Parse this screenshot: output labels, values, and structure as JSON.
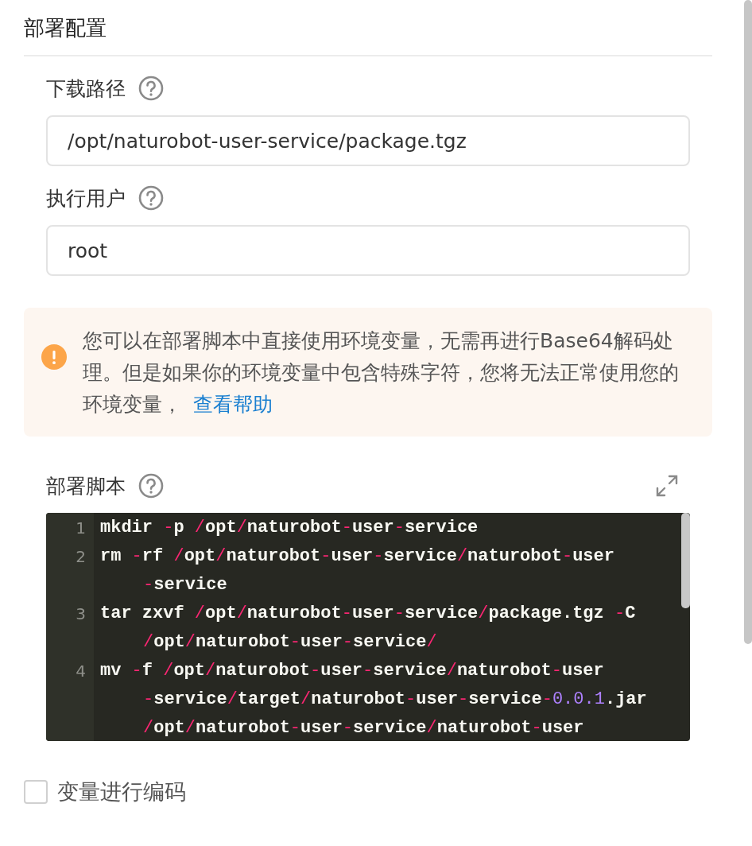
{
  "section": {
    "title": "部署配置"
  },
  "fields": [
    {
      "label": "下载路径",
      "value": "/opt/naturobot-user-service/package.tgz"
    },
    {
      "label": "执行用户",
      "value": "root"
    }
  ],
  "alert": {
    "text": "您可以在部署脚本中直接使用环境变量，无需再进行Base64解码处理。但是如果你的环境变量中包含特殊字符，您将无法正常使用您的环境变量，",
    "link": "查看帮助"
  },
  "script": {
    "label": "部署脚本",
    "lines": [
      {
        "number": "1",
        "rows": [
          "mkdir -p /opt/naturobot-user-service"
        ]
      },
      {
        "number": "2",
        "rows": [
          "rm -rf /opt/naturobot-user-service/naturobot-user",
          "-service"
        ]
      },
      {
        "number": "3",
        "rows": [
          "tar zxvf /opt/naturobot-user-service/package.tgz -C",
          "/opt/naturobot-user-service/"
        ]
      },
      {
        "number": "4",
        "rows": [
          "mv -f /opt/naturobot-user-service/naturobot-user",
          "-service/target/naturobot-user-service-0.0.1.jar",
          "/opt/naturobot-user-service/naturobot-user"
        ]
      }
    ]
  },
  "encode_checkbox": {
    "label": "变量进行编码",
    "checked": false
  }
}
